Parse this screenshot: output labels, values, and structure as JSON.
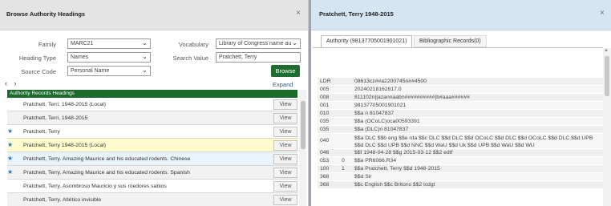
{
  "left_panel": {
    "title": "Browse Authority Headings",
    "close": "×",
    "form": {
      "family_label": "Family",
      "family_value": "MARC21",
      "heading_type_label": "Heading Type",
      "heading_type_value": "Names",
      "source_code_label": "Source Code",
      "source_code_value": "Personal Name",
      "vocabulary_label": "Vocabulary",
      "vocabulary_value": "Library of Congress name au",
      "search_value_label": "Search Value",
      "search_value": "Pratchett, Terry",
      "browse_label": "Browse",
      "chevron": "⌄"
    },
    "nav_arrows": "‹ ›",
    "expand_label": "Expand",
    "table_header": "Authority Records Headings",
    "rows": [
      {
        "star": "",
        "text": "Pratchett, Terri, 1948-2015 (Local)",
        "view": "View"
      },
      {
        "star": "",
        "text": "Pratchett, Terri, 1948-2015",
        "view": "View"
      },
      {
        "star": "★",
        "text": "Pratchett, Terry",
        "view": "View"
      },
      {
        "star": "★",
        "text": "Pratchett, Terry 1948-2015 (Local)",
        "view": "View"
      },
      {
        "star": "★",
        "text": "Pratchett, Terry. Amazing Maurice and his educated rodents. Chinese",
        "view": "View"
      },
      {
        "star": "★",
        "text": "Pratchett, Terry. Amazing Maurice and his educated rodents. Spanish",
        "view": "View"
      },
      {
        "star": "",
        "text": "Pratchett, Terry. Asombroso Mauricio y sus roedores sabios",
        "view": "View"
      },
      {
        "star": "",
        "text": "Pratchett, Terry. Atlético invisible",
        "view": "View"
      }
    ]
  },
  "right_panel": {
    "title": "Pratchett, Terry 1948-2015",
    "close": "×",
    "tabs": [
      "Authority (98137705001901021)",
      "Bibliographic Records(0)"
    ],
    "marc": [
      {
        "tag": "LDR",
        "ind": "",
        "value": "08613cz##a2200745n##4500"
      },
      {
        "tag": "005",
        "ind": "",
        "value": "20240218162817.0"
      },
      {
        "tag": "008",
        "ind": "",
        "value": "811102n||azannaabn##########|b#aaa######"
      },
      {
        "tag": "001",
        "ind": "",
        "value": "98137705001901021"
      },
      {
        "tag": "010",
        "ind": "",
        "value": "$$a n 81047837"
      },
      {
        "tag": "035",
        "ind": "",
        "value": "$$a (OCoLC)oca00593391"
      },
      {
        "tag": "035",
        "ind": "",
        "value": "$$a (DLC)n 81047837"
      },
      {
        "tag": "040",
        "ind": "",
        "value": "$$a DLC $$b eng $$e rda $$c DLC $$d DLC $$d OCoLC $$d DLC $$d OCoLC $$d DLC $$d UPB $$d DLC $$d UPB $$d NNC $$d WaU $$d Uk $$d UPB $$d WaU $$d WU"
      },
      {
        "tag": "046",
        "ind": "",
        "value": "$$f 1948-04-28 $$g 2015-03-12 $$2 edtf"
      },
      {
        "tag": "053",
        "ind": "0",
        "value": "$$a PR6066.R34"
      },
      {
        "tag": "100",
        "ind": "1",
        "value": "$$a Pratchett, Terry $$d 1948-2015"
      },
      {
        "tag": "368",
        "ind": "",
        "value": "$$d Sir"
      },
      {
        "tag": "368",
        "ind": "",
        "value": "$$c English $$c Britons $$2 lcdgt"
      }
    ]
  }
}
